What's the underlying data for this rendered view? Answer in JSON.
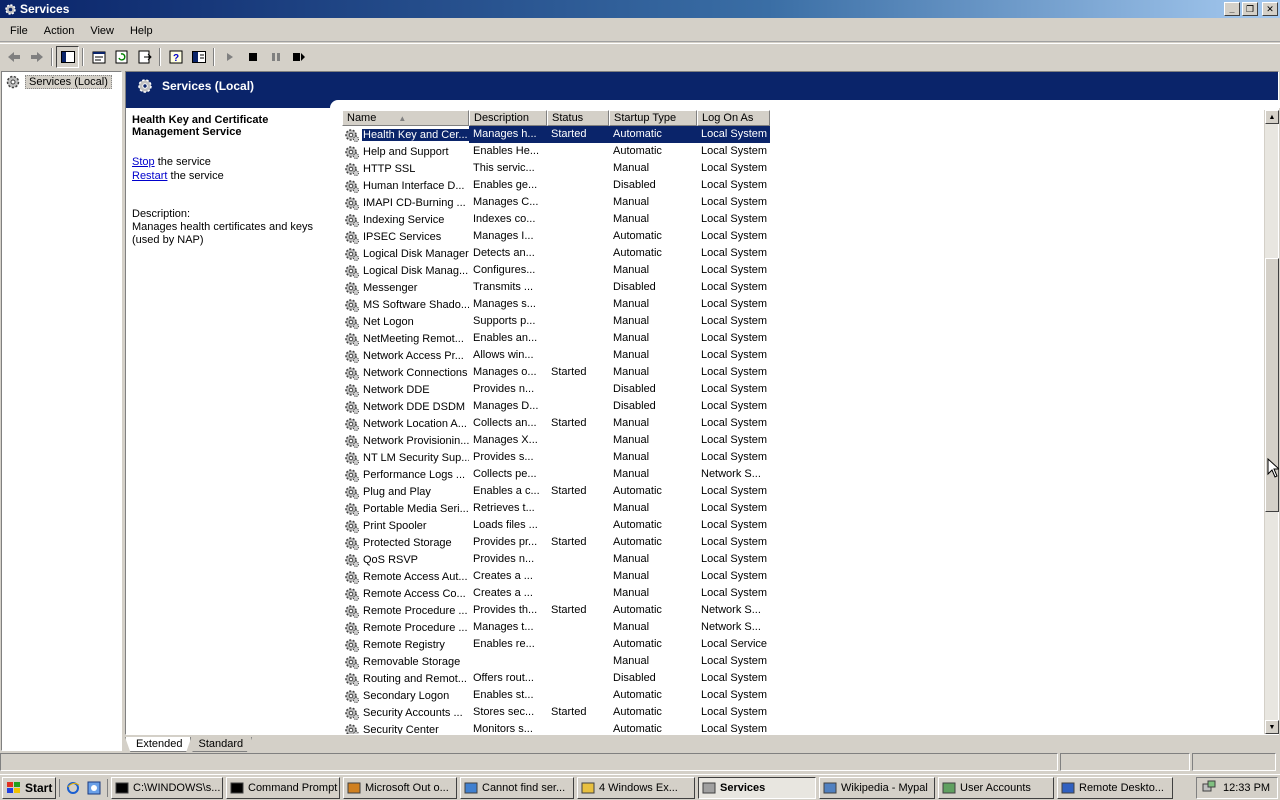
{
  "window": {
    "title": "Services",
    "buttons": [
      "_",
      "❐",
      "✕"
    ]
  },
  "menu": [
    "File",
    "Action",
    "View",
    "Help"
  ],
  "tree": {
    "root_label": "Services (Local)"
  },
  "panel": {
    "header": "Services (Local)",
    "service_title": "Health Key and Certificate Management Service",
    "stop_link": "Stop",
    "stop_suffix": " the service",
    "restart_link": "Restart",
    "restart_suffix": " the service",
    "description_label": "Description:",
    "description_text": "Manages health certificates and keys (used by NAP)"
  },
  "columns": {
    "name": "Name",
    "description": "Description",
    "status": "Status",
    "startup": "Startup Type",
    "logon": "Log On As"
  },
  "services": [
    [
      "Health Key and Cer...",
      "Manages h...",
      "Started",
      "Automatic",
      "Local System"
    ],
    [
      "Help and Support",
      "Enables He...",
      "",
      "Automatic",
      "Local System"
    ],
    [
      "HTTP SSL",
      "This servic...",
      "",
      "Manual",
      "Local System"
    ],
    [
      "Human Interface D...",
      "Enables ge...",
      "",
      "Disabled",
      "Local System"
    ],
    [
      "IMAPI CD-Burning ...",
      "Manages C...",
      "",
      "Manual",
      "Local System"
    ],
    [
      "Indexing Service",
      "Indexes co...",
      "",
      "Manual",
      "Local System"
    ],
    [
      "IPSEC Services",
      "Manages I...",
      "",
      "Automatic",
      "Local System"
    ],
    [
      "Logical Disk Manager",
      "Detects an...",
      "",
      "Automatic",
      "Local System"
    ],
    [
      "Logical Disk Manag...",
      "Configures...",
      "",
      "Manual",
      "Local System"
    ],
    [
      "Messenger",
      "Transmits ...",
      "",
      "Disabled",
      "Local System"
    ],
    [
      "MS Software Shado...",
      "Manages s...",
      "",
      "Manual",
      "Local System"
    ],
    [
      "Net Logon",
      "Supports p...",
      "",
      "Manual",
      "Local System"
    ],
    [
      "NetMeeting Remot...",
      "Enables an...",
      "",
      "Manual",
      "Local System"
    ],
    [
      "Network Access Pr...",
      "Allows win...",
      "",
      "Manual",
      "Local System"
    ],
    [
      "Network Connections",
      "Manages o...",
      "Started",
      "Manual",
      "Local System"
    ],
    [
      "Network DDE",
      "Provides n...",
      "",
      "Disabled",
      "Local System"
    ],
    [
      "Network DDE DSDM",
      "Manages D...",
      "",
      "Disabled",
      "Local System"
    ],
    [
      "Network Location A...",
      "Collects an...",
      "Started",
      "Manual",
      "Local System"
    ],
    [
      "Network Provisionin...",
      "Manages X...",
      "",
      "Manual",
      "Local System"
    ],
    [
      "NT LM Security Sup...",
      "Provides s...",
      "",
      "Manual",
      "Local System"
    ],
    [
      "Performance Logs ...",
      "Collects pe...",
      "",
      "Manual",
      "Network S..."
    ],
    [
      "Plug and Play",
      "Enables a c...",
      "Started",
      "Automatic",
      "Local System"
    ],
    [
      "Portable Media Seri...",
      "Retrieves t...",
      "",
      "Manual",
      "Local System"
    ],
    [
      "Print Spooler",
      "Loads files ...",
      "",
      "Automatic",
      "Local System"
    ],
    [
      "Protected Storage",
      "Provides pr...",
      "Started",
      "Automatic",
      "Local System"
    ],
    [
      "QoS RSVP",
      "Provides n...",
      "",
      "Manual",
      "Local System"
    ],
    [
      "Remote Access Aut...",
      "Creates a ...",
      "",
      "Manual",
      "Local System"
    ],
    [
      "Remote Access Co...",
      "Creates a ...",
      "",
      "Manual",
      "Local System"
    ],
    [
      "Remote Procedure ...",
      "Provides th...",
      "Started",
      "Automatic",
      "Network S..."
    ],
    [
      "Remote Procedure ...",
      "Manages t...",
      "",
      "Manual",
      "Network S..."
    ],
    [
      "Remote Registry",
      "Enables re...",
      "",
      "Automatic",
      "Local Service"
    ],
    [
      "Removable Storage",
      "",
      "",
      "Manual",
      "Local System"
    ],
    [
      "Routing and Remot...",
      "Offers rout...",
      "",
      "Disabled",
      "Local System"
    ],
    [
      "Secondary Logon",
      "Enables st...",
      "",
      "Automatic",
      "Local System"
    ],
    [
      "Security Accounts ...",
      "Stores sec...",
      "Started",
      "Automatic",
      "Local System"
    ],
    [
      "Security Center",
      "Monitors s...",
      "",
      "Automatic",
      "Local System"
    ]
  ],
  "tabs": [
    "Extended",
    "Standard"
  ],
  "taskbar": {
    "start": "Start",
    "tasks": [
      "C:\\WINDOWS\\s...",
      "Command Prompt",
      "Microsoft Out o...",
      "Cannot find ser...",
      "4 Windows Ex...",
      "Services",
      "Wikipedia - Mypal",
      "User Accounts",
      "Remote Deskto..."
    ],
    "clock": "12:33 PM"
  }
}
